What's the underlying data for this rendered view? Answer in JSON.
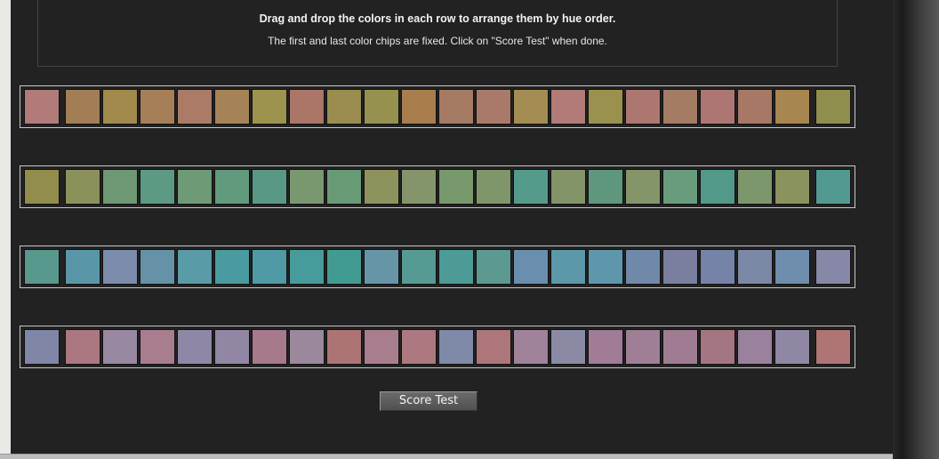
{
  "instructions": {
    "title": "Drag and drop the colors in each row to arrange them by hue order.",
    "subtitle": "The first and last color chips are fixed. Click on \"Score Test\" when done."
  },
  "score_button_label": "Score Test",
  "rows": [
    {
      "name": "row-1",
      "first": "#b07b78",
      "chips": [
        "#a37d55",
        "#a28a4c",
        "#a67f58",
        "#ab7b67",
        "#a68357",
        "#9d934f",
        "#ab7568",
        "#9a8d4f",
        "#96914f",
        "#a97d4e",
        "#a57b64",
        "#a97a69",
        "#a48d52",
        "#b17b77",
        "#9a914f",
        "#ad7771",
        "#a47b63",
        "#ad7673",
        "#a67865",
        "#a88650"
      ],
      "last": "#8f8e4c"
    },
    {
      "name": "row-2",
      "first": "#928d4c",
      "chips": [
        "#8c915b",
        "#6d9873",
        "#5c9a84",
        "#6e9a76",
        "#629a7d",
        "#5a9886",
        "#7a9870",
        "#699a76",
        "#8e935d",
        "#84956b",
        "#77996c",
        "#7e9669",
        "#559b8c",
        "#839469",
        "#5e977e",
        "#84956a",
        "#699c7c",
        "#52998a",
        "#7d976c",
        "#8a935d"
      ],
      "last": "#529a91"
    },
    {
      "name": "row-3",
      "first": "#59988c",
      "chips": [
        "#5997a8",
        "#7c8cad",
        "#6592a6",
        "#599ba6",
        "#4a9b9f",
        "#4f9aa4",
        "#479b9a",
        "#429b92",
        "#6795a8",
        "#559a93",
        "#4c9b97",
        "#5c9990",
        "#6a8eae",
        "#5c97aa",
        "#5e96ac",
        "#7089a8",
        "#7a7e9f",
        "#7583a8",
        "#7b88a6",
        "#6f8dad"
      ],
      "last": "#8788a7"
    },
    {
      "name": "row-4",
      "first": "#8086a5",
      "chips": [
        "#ab7781",
        "#9888a2",
        "#a77d8f",
        "#8f87a6",
        "#9186a4",
        "#a7798c",
        "#9c889c",
        "#ac7474",
        "#a87e8e",
        "#ad787f",
        "#7f8aa8",
        "#ad767b",
        "#a0829b",
        "#8b8aa5",
        "#a07c97",
        "#9e7f96",
        "#a07c92",
        "#a47682",
        "#9a819d",
        "#8f87a4"
      ],
      "last": "#ae7574"
    }
  ]
}
